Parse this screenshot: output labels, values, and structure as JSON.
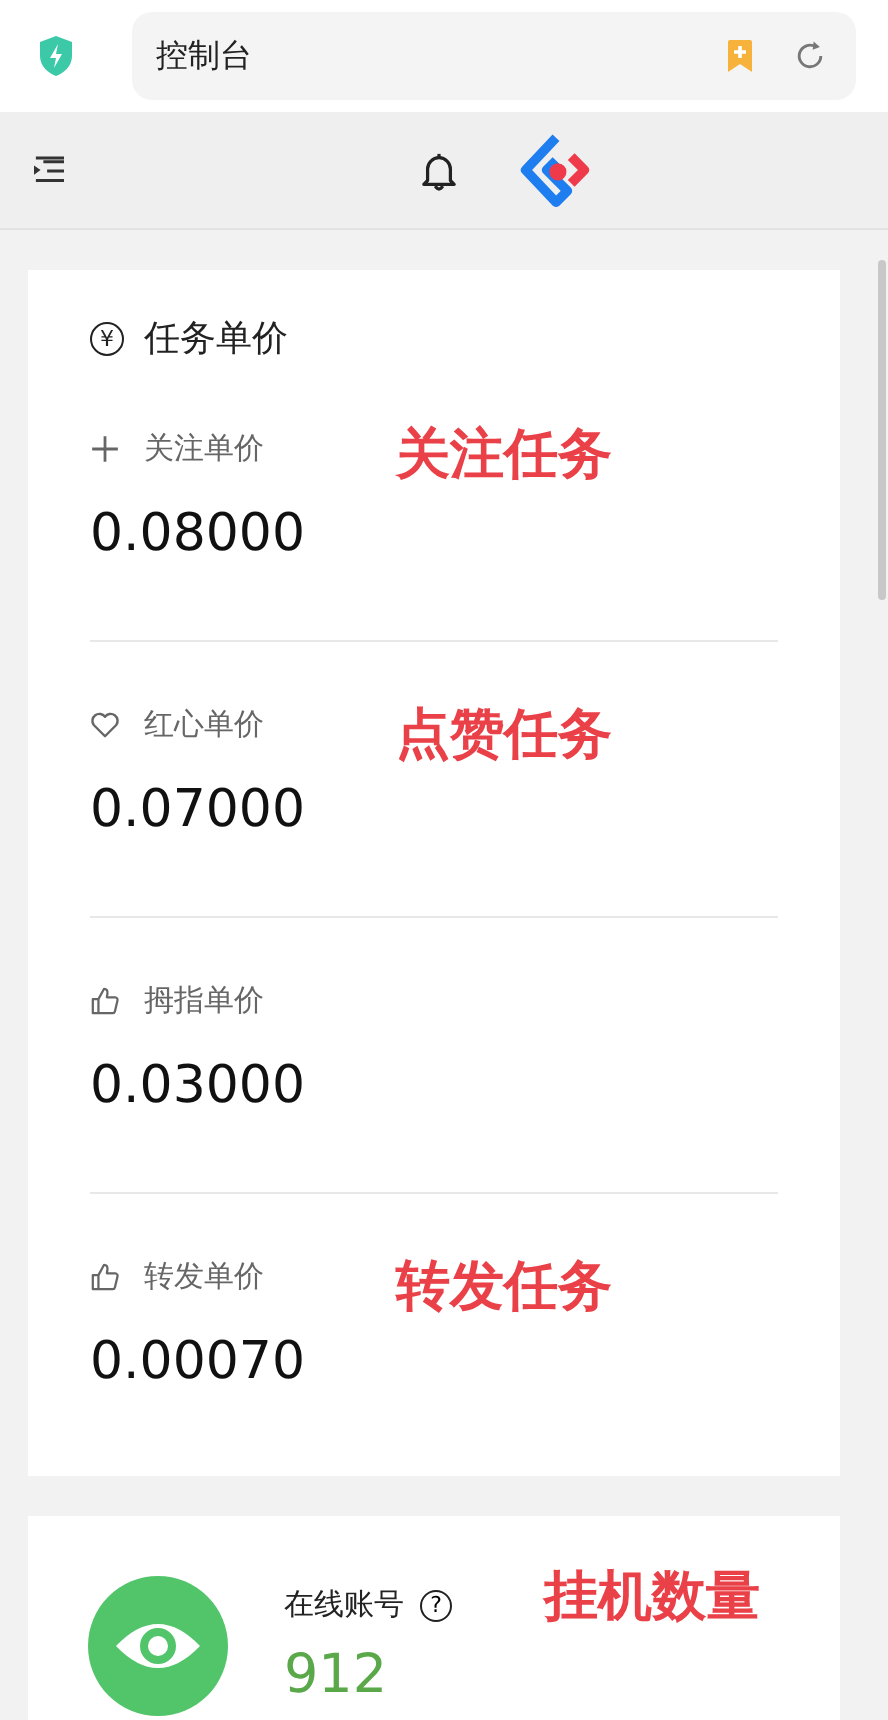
{
  "browser": {
    "address": "控制台"
  },
  "card": {
    "currency_symbol": "¥",
    "title": "任务单价",
    "items": [
      {
        "kind": "plus",
        "label": "关注单价",
        "value": "0.08000",
        "annotation": "关注任务"
      },
      {
        "kind": "heart",
        "label": "红心单价",
        "value": "0.07000",
        "annotation": "点赞任务"
      },
      {
        "kind": "thumb",
        "label": "拇指单价",
        "value": "0.03000"
      },
      {
        "kind": "thumb",
        "label": "转发单价",
        "value": "0.00070",
        "annotation": "转发任务"
      }
    ]
  },
  "online": {
    "label": "在线账号",
    "help": "?",
    "value": "912",
    "annotation": "挂机数量"
  }
}
